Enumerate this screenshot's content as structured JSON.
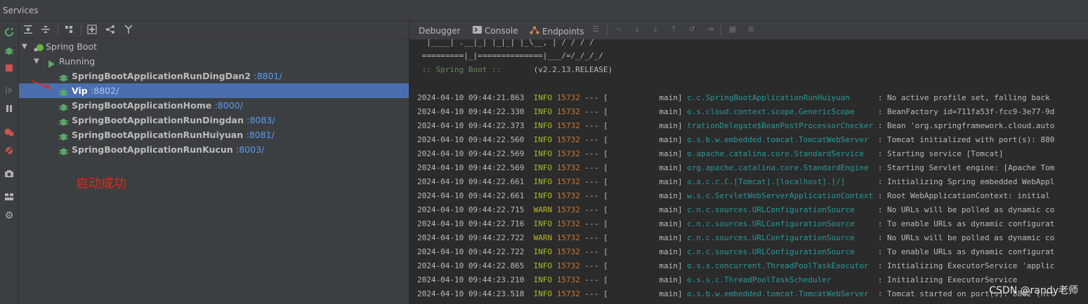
{
  "window": {
    "title": "Services"
  },
  "tree": {
    "root": {
      "label": "Spring Boot"
    },
    "group": {
      "label": "Running"
    },
    "apps": [
      {
        "name": "SpringBootApplicationRunDingDan2",
        "port": ":8801/"
      },
      {
        "name": "Vip",
        "port": ":8802/"
      },
      {
        "name": "SpringBootApplicationHome",
        "port": ":8000/"
      },
      {
        "name": "SpringBootApplicationRunDingdan",
        "port": ":8083/"
      },
      {
        "name": "SpringBootApplicationRunHuiyuan",
        "port": ":8081/"
      },
      {
        "name": "SpringBootApplicationRunKucun",
        "port": ":8003/"
      }
    ],
    "selected_index": 1
  },
  "annotation": {
    "text": "启动成功"
  },
  "console": {
    "tabs": [
      {
        "label": "Debugger"
      },
      {
        "label": "Console"
      },
      {
        "label": "Endpoints"
      }
    ],
    "banner": [
      "  |____| .__|_| |_|_| |_\\__, | / / / /",
      " =========|_|==============|___/=/_/_/_/",
      " :: Spring Boot ::       (v2.2.13.RELEASE)"
    ],
    "lines": [
      {
        "ts": "2024-04-10 09:44:21.863",
        "level": "INFO",
        "pid": "15732",
        "thread": "main",
        "logger": "c.c.SpringBootApplicationRunHuiyuan",
        "msg": ": No active profile set, falling back"
      },
      {
        "ts": "2024-04-10 09:44:22.330",
        "level": "INFO",
        "pid": "15732",
        "thread": "main",
        "logger": "o.s.cloud.context.scope.GenericScope",
        "msg": ": BeanFactory id=711fa53f-fcc9-3e77-9d"
      },
      {
        "ts": "2024-04-10 09:44:22.373",
        "level": "INFO",
        "pid": "15732",
        "thread": "main",
        "logger": "trationDelegate$BeanPostProcessorChecker",
        "msg": ": Bean 'org.springframework.cloud.auto"
      },
      {
        "ts": "2024-04-10 09:44:22.560",
        "level": "INFO",
        "pid": "15732",
        "thread": "main",
        "logger": "o.s.b.w.embedded.tomcat.TomcatWebServer",
        "msg": ": Tomcat initialized with port(s): 880"
      },
      {
        "ts": "2024-04-10 09:44:22.569",
        "level": "INFO",
        "pid": "15732",
        "thread": "main",
        "logger": "o.apache.catalina.core.StandardService",
        "msg": ": Starting service [Tomcat]"
      },
      {
        "ts": "2024-04-10 09:44:22.569",
        "level": "INFO",
        "pid": "15732",
        "thread": "main",
        "logger": "org.apache.catalina.core.StandardEngine",
        "msg": ": Starting Servlet engine: [Apache Tom"
      },
      {
        "ts": "2024-04-10 09:44:22.661",
        "level": "INFO",
        "pid": "15732",
        "thread": "main",
        "logger": "o.a.c.c.C.[Tomcat].[localhost].[/]",
        "msg": ": Initializing Spring embedded WebAppl"
      },
      {
        "ts": "2024-04-10 09:44:22.661",
        "level": "INFO",
        "pid": "15732",
        "thread": "main",
        "logger": "w.s.c.ServletWebServerApplicationContext",
        "msg": ": Root WebApplicationContext: initial"
      },
      {
        "ts": "2024-04-10 09:44:22.715",
        "level": "WARN",
        "pid": "15732",
        "thread": "main",
        "logger": "c.n.c.sources.URLConfigurationSource",
        "msg": ": No URLs will be polled as dynamic co"
      },
      {
        "ts": "2024-04-10 09:44:22.716",
        "level": "INFO",
        "pid": "15732",
        "thread": "main",
        "logger": "c.n.c.sources.URLConfigurationSource",
        "msg": ": To enable URLs as dynamic configurat"
      },
      {
        "ts": "2024-04-10 09:44:22.722",
        "level": "WARN",
        "pid": "15732",
        "thread": "main",
        "logger": "c.n.c.sources.URLConfigurationSource",
        "msg": ": No URLs will be polled as dynamic co"
      },
      {
        "ts": "2024-04-10 09:44:22.722",
        "level": "INFO",
        "pid": "15732",
        "thread": "main",
        "logger": "c.n.c.sources.URLConfigurationSource",
        "msg": ": To enable URLs as dynamic configurat"
      },
      {
        "ts": "2024-04-10 09:44:22.865",
        "level": "INFO",
        "pid": "15732",
        "thread": "main",
        "logger": "o.s.s.concurrent.ThreadPoolTaskExecutor",
        "msg": ": Initializing ExecutorService 'applic"
      },
      {
        "ts": "2024-04-10 09:44:23.210",
        "level": "INFO",
        "pid": "15732",
        "thread": "main",
        "logger": "o.s.s.c.ThreadPoolTaskScheduler",
        "msg": ": Initializing ExecutorService"
      },
      {
        "ts": "2024-04-10 09:44:23.518",
        "level": "INFO",
        "pid": "15732",
        "thread": "main",
        "logger": "o.s.b.w.embedded.tomcat.TomcatWebServer",
        "msg": ": Tomcat started on port(s): 8802 (htt"
      }
    ]
  },
  "watermark": {
    "text": "CSDN @randy老师"
  },
  "colors": {
    "selection": "#4b6eaf",
    "port": "#589df6",
    "logger": "#299999",
    "pid": "#cc7832",
    "annotation": "#e0281e"
  }
}
